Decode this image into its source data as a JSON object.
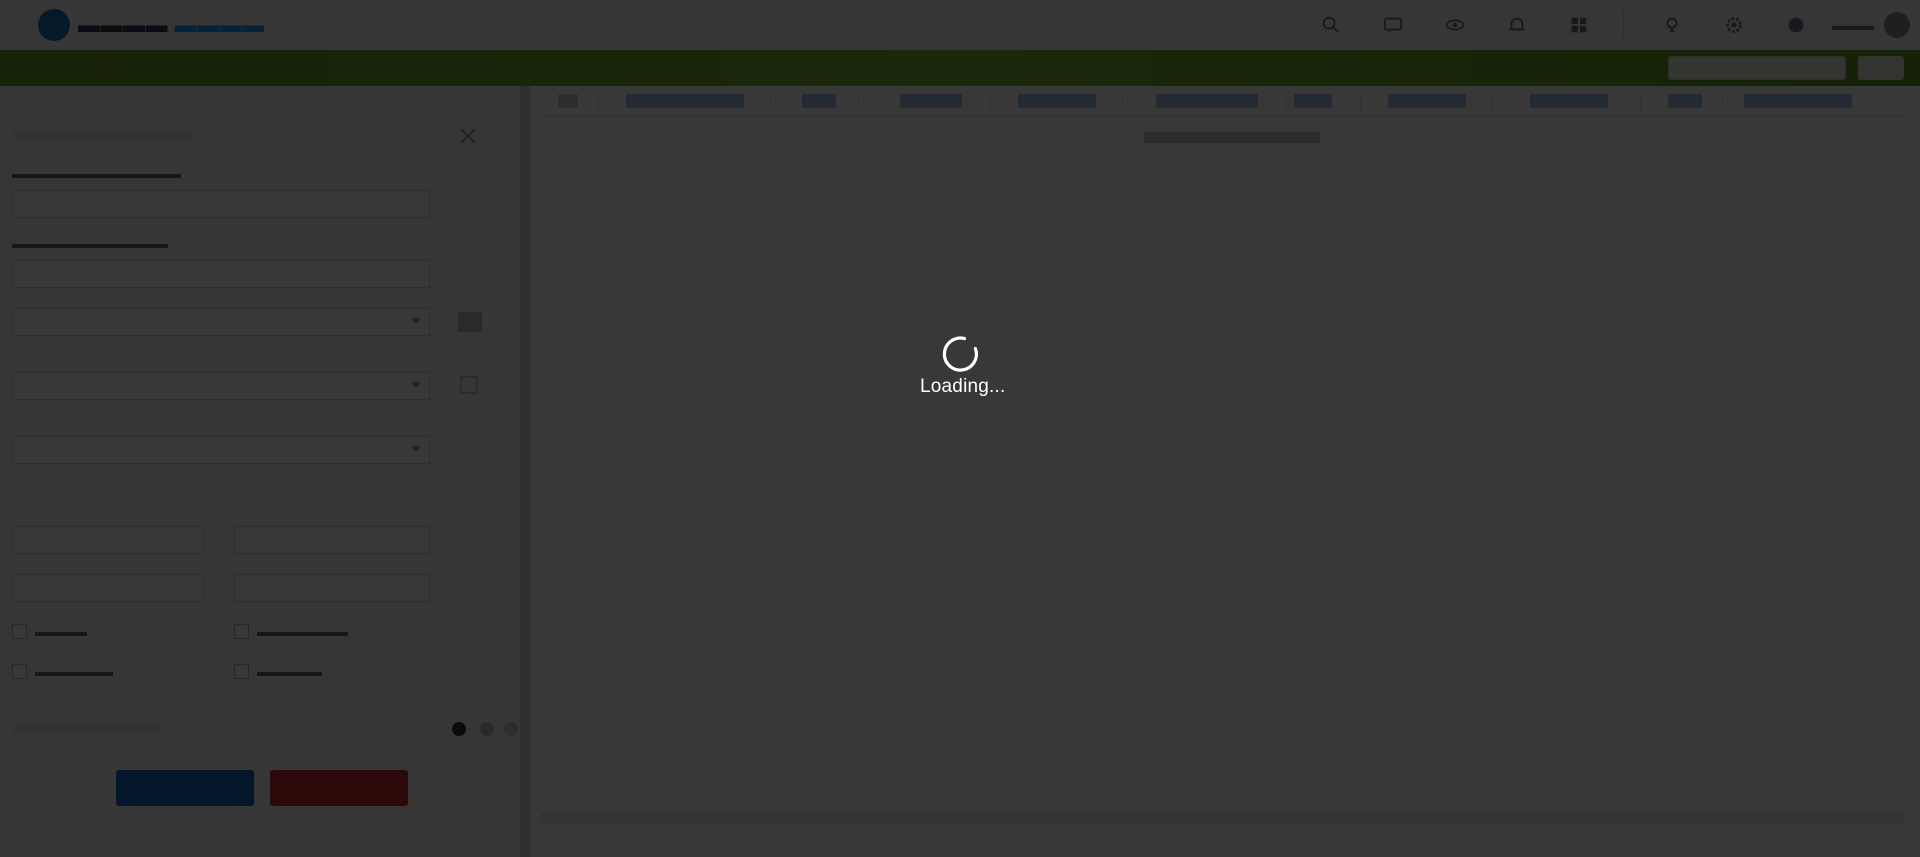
{
  "loading": {
    "text": "Loading..."
  },
  "colors": {
    "overlay": "#000000c7",
    "brand_green": "#79b534",
    "primary_button": "#1565c0",
    "danger_button": "#c62828",
    "spinner": "#ffffff"
  },
  "header": {
    "icons": [
      "search-icon",
      "chat-icon",
      "eye-icon",
      "bell-icon",
      "grid-icon",
      "lightbulb-icon",
      "gear-icon",
      "help-icon"
    ],
    "user_avatar": "avatar-icon"
  }
}
